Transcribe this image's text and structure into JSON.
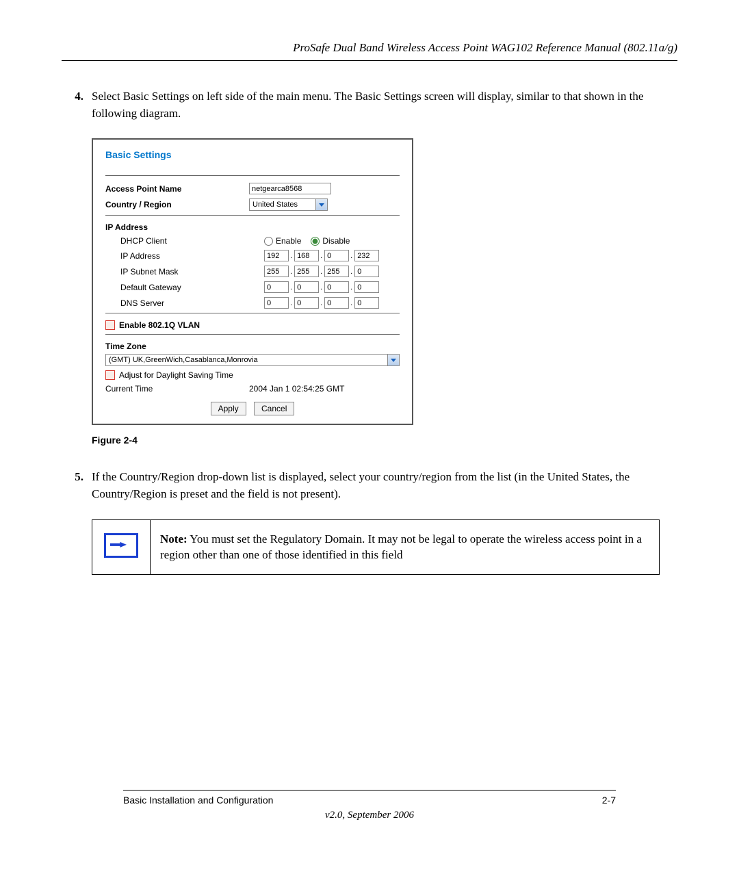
{
  "header": {
    "title": "ProSafe Dual Band Wireless Access Point WAG102 Reference Manual (802.11a/g)"
  },
  "steps": {
    "s4": {
      "num": "4.",
      "text": "Select Basic Settings on left side of the main menu. The Basic Settings screen will display, similar to that shown in the following diagram."
    },
    "s5": {
      "num": "5.",
      "text": "If the Country/Region drop-down list is displayed, select your country/region from the list (in the United States, the Country/Region is preset and the field is not present)."
    }
  },
  "screenshot": {
    "title": "Basic Settings",
    "apName": {
      "label": "Access Point Name",
      "value": "netgearca8568"
    },
    "country": {
      "label": "Country / Region",
      "value": "United States"
    },
    "ipSection": "IP Address",
    "dhcp": {
      "label": "DHCP Client",
      "enable": "Enable",
      "disable": "Disable",
      "selected": "disable"
    },
    "ip": {
      "label": "IP Address",
      "o1": "192",
      "o2": "168",
      "o3": "0",
      "o4": "232"
    },
    "mask": {
      "label": "IP Subnet Mask",
      "o1": "255",
      "o2": "255",
      "o3": "255",
      "o4": "0"
    },
    "gateway": {
      "label": "Default Gateway",
      "o1": "0",
      "o2": "0",
      "o3": "0",
      "o4": "0"
    },
    "dns": {
      "label": "DNS Server",
      "o1": "0",
      "o2": "0",
      "o3": "0",
      "o4": "0"
    },
    "vlan": {
      "label": "Enable 802.1Q VLAN"
    },
    "tz": {
      "label": "Time Zone",
      "value": "(GMT) UK,GreenWich,Casablanca,Monrovia"
    },
    "dst": {
      "label": "Adjust for Daylight Saving Time"
    },
    "currentTime": {
      "label": "Current Time",
      "value": "2004 Jan 1 02:54:25 GMT"
    },
    "buttons": {
      "apply": "Apply",
      "cancel": "Cancel"
    }
  },
  "figure": {
    "caption": "Figure 2-4"
  },
  "note": {
    "label": "Note:",
    "text": " You must set the Regulatory Domain. It may not be legal to operate the wireless access point in a region other than one of those identified in this field"
  },
  "footer": {
    "left": "Basic Installation and Configuration",
    "right": "2-7",
    "sub": "v2.0, September 2006"
  }
}
